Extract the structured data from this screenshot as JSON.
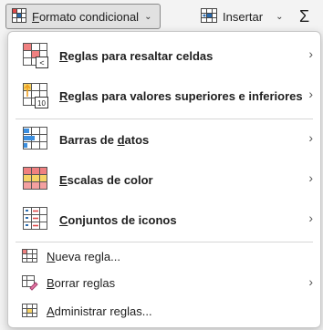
{
  "ribbon": {
    "conditional_format": {
      "label": "Formato condicional",
      "underline_char": "F",
      "rest": "ormato condicional",
      "chevron": "⌄"
    },
    "insert": {
      "label": "Insertar",
      "chevron": "⌄"
    },
    "sum": {
      "glyph": "Σ"
    }
  },
  "menu": {
    "items": [
      {
        "label": "Reglas para resaltar celdas",
        "pre": "",
        "u": "R",
        "post": "eglas para resaltar celdas",
        "icon": "highlight-cells-rules-icon",
        "submenu": true,
        "arrow": "›"
      },
      {
        "label": "Reglas para valores superiores e inferiores",
        "pre": "",
        "u": "R",
        "post": "eglas para valores superiores e inferiores",
        "icon": "top-bottom-rules-icon",
        "submenu": true,
        "arrow": "›"
      },
      {
        "label": "Barras de datos",
        "pre": "Barras de ",
        "u": "d",
        "post": "atos",
        "icon": "data-bars-icon",
        "submenu": true,
        "arrow": "›"
      },
      {
        "label": "Escalas de color",
        "pre": "",
        "u": "E",
        "post": "scalas de color",
        "icon": "color-scales-icon",
        "submenu": true,
        "arrow": "›"
      },
      {
        "label": "Conjuntos de iconos",
        "pre": "",
        "u": "C",
        "post": "onjuntos de iconos",
        "icon": "icon-sets-icon",
        "submenu": true,
        "arrow": "›"
      },
      {
        "label": "Nueva regla...",
        "pre": "",
        "u": "N",
        "post": "ueva regla...",
        "icon": "new-rule-icon",
        "submenu": false
      },
      {
        "label": "Borrar reglas",
        "pre": "",
        "u": "B",
        "post": "orrar reglas",
        "icon": "clear-rules-icon",
        "submenu": true,
        "arrow": "›"
      },
      {
        "label": "Administrar reglas...",
        "pre": "",
        "u": "A",
        "post": "dministrar reglas...",
        "icon": "manage-rules-icon",
        "submenu": false
      }
    ]
  },
  "icon_glyphs": {
    "less_than": "<",
    "ten": "10"
  },
  "colors": {
    "accent_blue": "#2b6cb0",
    "data_bar_blue": "#3b8fe0",
    "scale_red": "#f08080",
    "scale_yellow": "#f6d365",
    "arrow_orange": "#f0a020"
  }
}
